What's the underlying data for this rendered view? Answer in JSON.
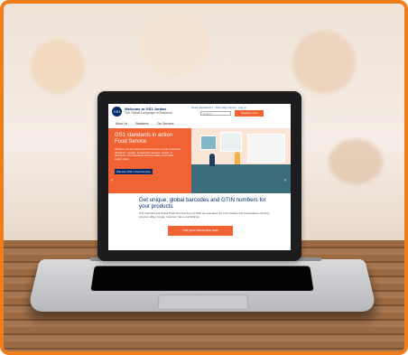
{
  "site": {
    "logo_text": "GS1",
    "title": "Welcome to GS1 Jordan",
    "tagline": "The Global Language of Business",
    "top_links": "Need Assistance? · GS1 Help Centre · Log in",
    "search_placeholder": "Search",
    "register_label": "Register now"
  },
  "nav": {
    "items": [
      "About Us",
      "Standards",
      "Our Services"
    ]
  },
  "hero": {
    "title": "GS1 standards in action Food Service",
    "body": "Whether you are delivering food items to a local restaurant, distributor, supplier, foodservice operator, retailer, or distributor, GS1 standards help to enable a traceable supply chain.",
    "button_label": "Discover GS1 in Food Service",
    "prev": "‹",
    "next": "›"
  },
  "main": {
    "headline": "Get unique, global barcodes and GTIN numbers for your products",
    "body": "GS1 barcodes and Global Trade Item Numbers (GTINs) are mandatory for most retailers and marketplaces including Amazon, eBay, Google, Carrefour, Tesco and Walmart.",
    "cta_label": "Get your barcodes now"
  },
  "colors": {
    "frame": "#f07d1a",
    "brand_orange": "#f26334",
    "brand_blue": "#002c6c"
  }
}
